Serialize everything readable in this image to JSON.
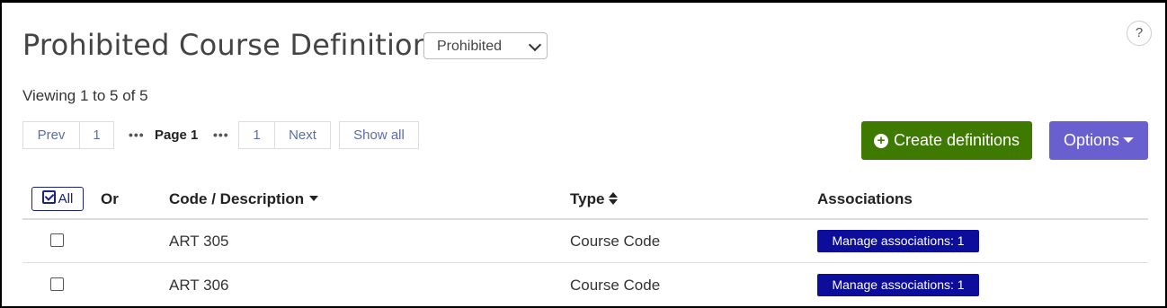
{
  "page": {
    "title": "Prohibited Course Definitions",
    "filter_select": {
      "selected": "Prohibited"
    },
    "help_label": "?",
    "viewing_text": "Viewing 1 to 5 of 5"
  },
  "pagination": {
    "prev": "Prev",
    "first_page": "1",
    "dots": "•••",
    "current_label": "Page 1",
    "last_page": "1",
    "next": "Next",
    "show_all": "Show all"
  },
  "actions": {
    "create_label": "Create definitions",
    "create_icon": "plus-circle-icon",
    "options_label": "Options",
    "create_color": "#3f7a00",
    "options_color": "#6a5fcf"
  },
  "table": {
    "select_all_label": "All",
    "headers": {
      "or": "Or",
      "code": "Code / Description",
      "type": "Type",
      "associations": "Associations"
    },
    "rows": [
      {
        "code": "ART 305",
        "type": "Course Code",
        "associations": "Manage associations: 1"
      },
      {
        "code": "ART 306",
        "type": "Course Code",
        "associations": "Manage associations: 1"
      }
    ],
    "badge_color": "#0d0d9c"
  }
}
